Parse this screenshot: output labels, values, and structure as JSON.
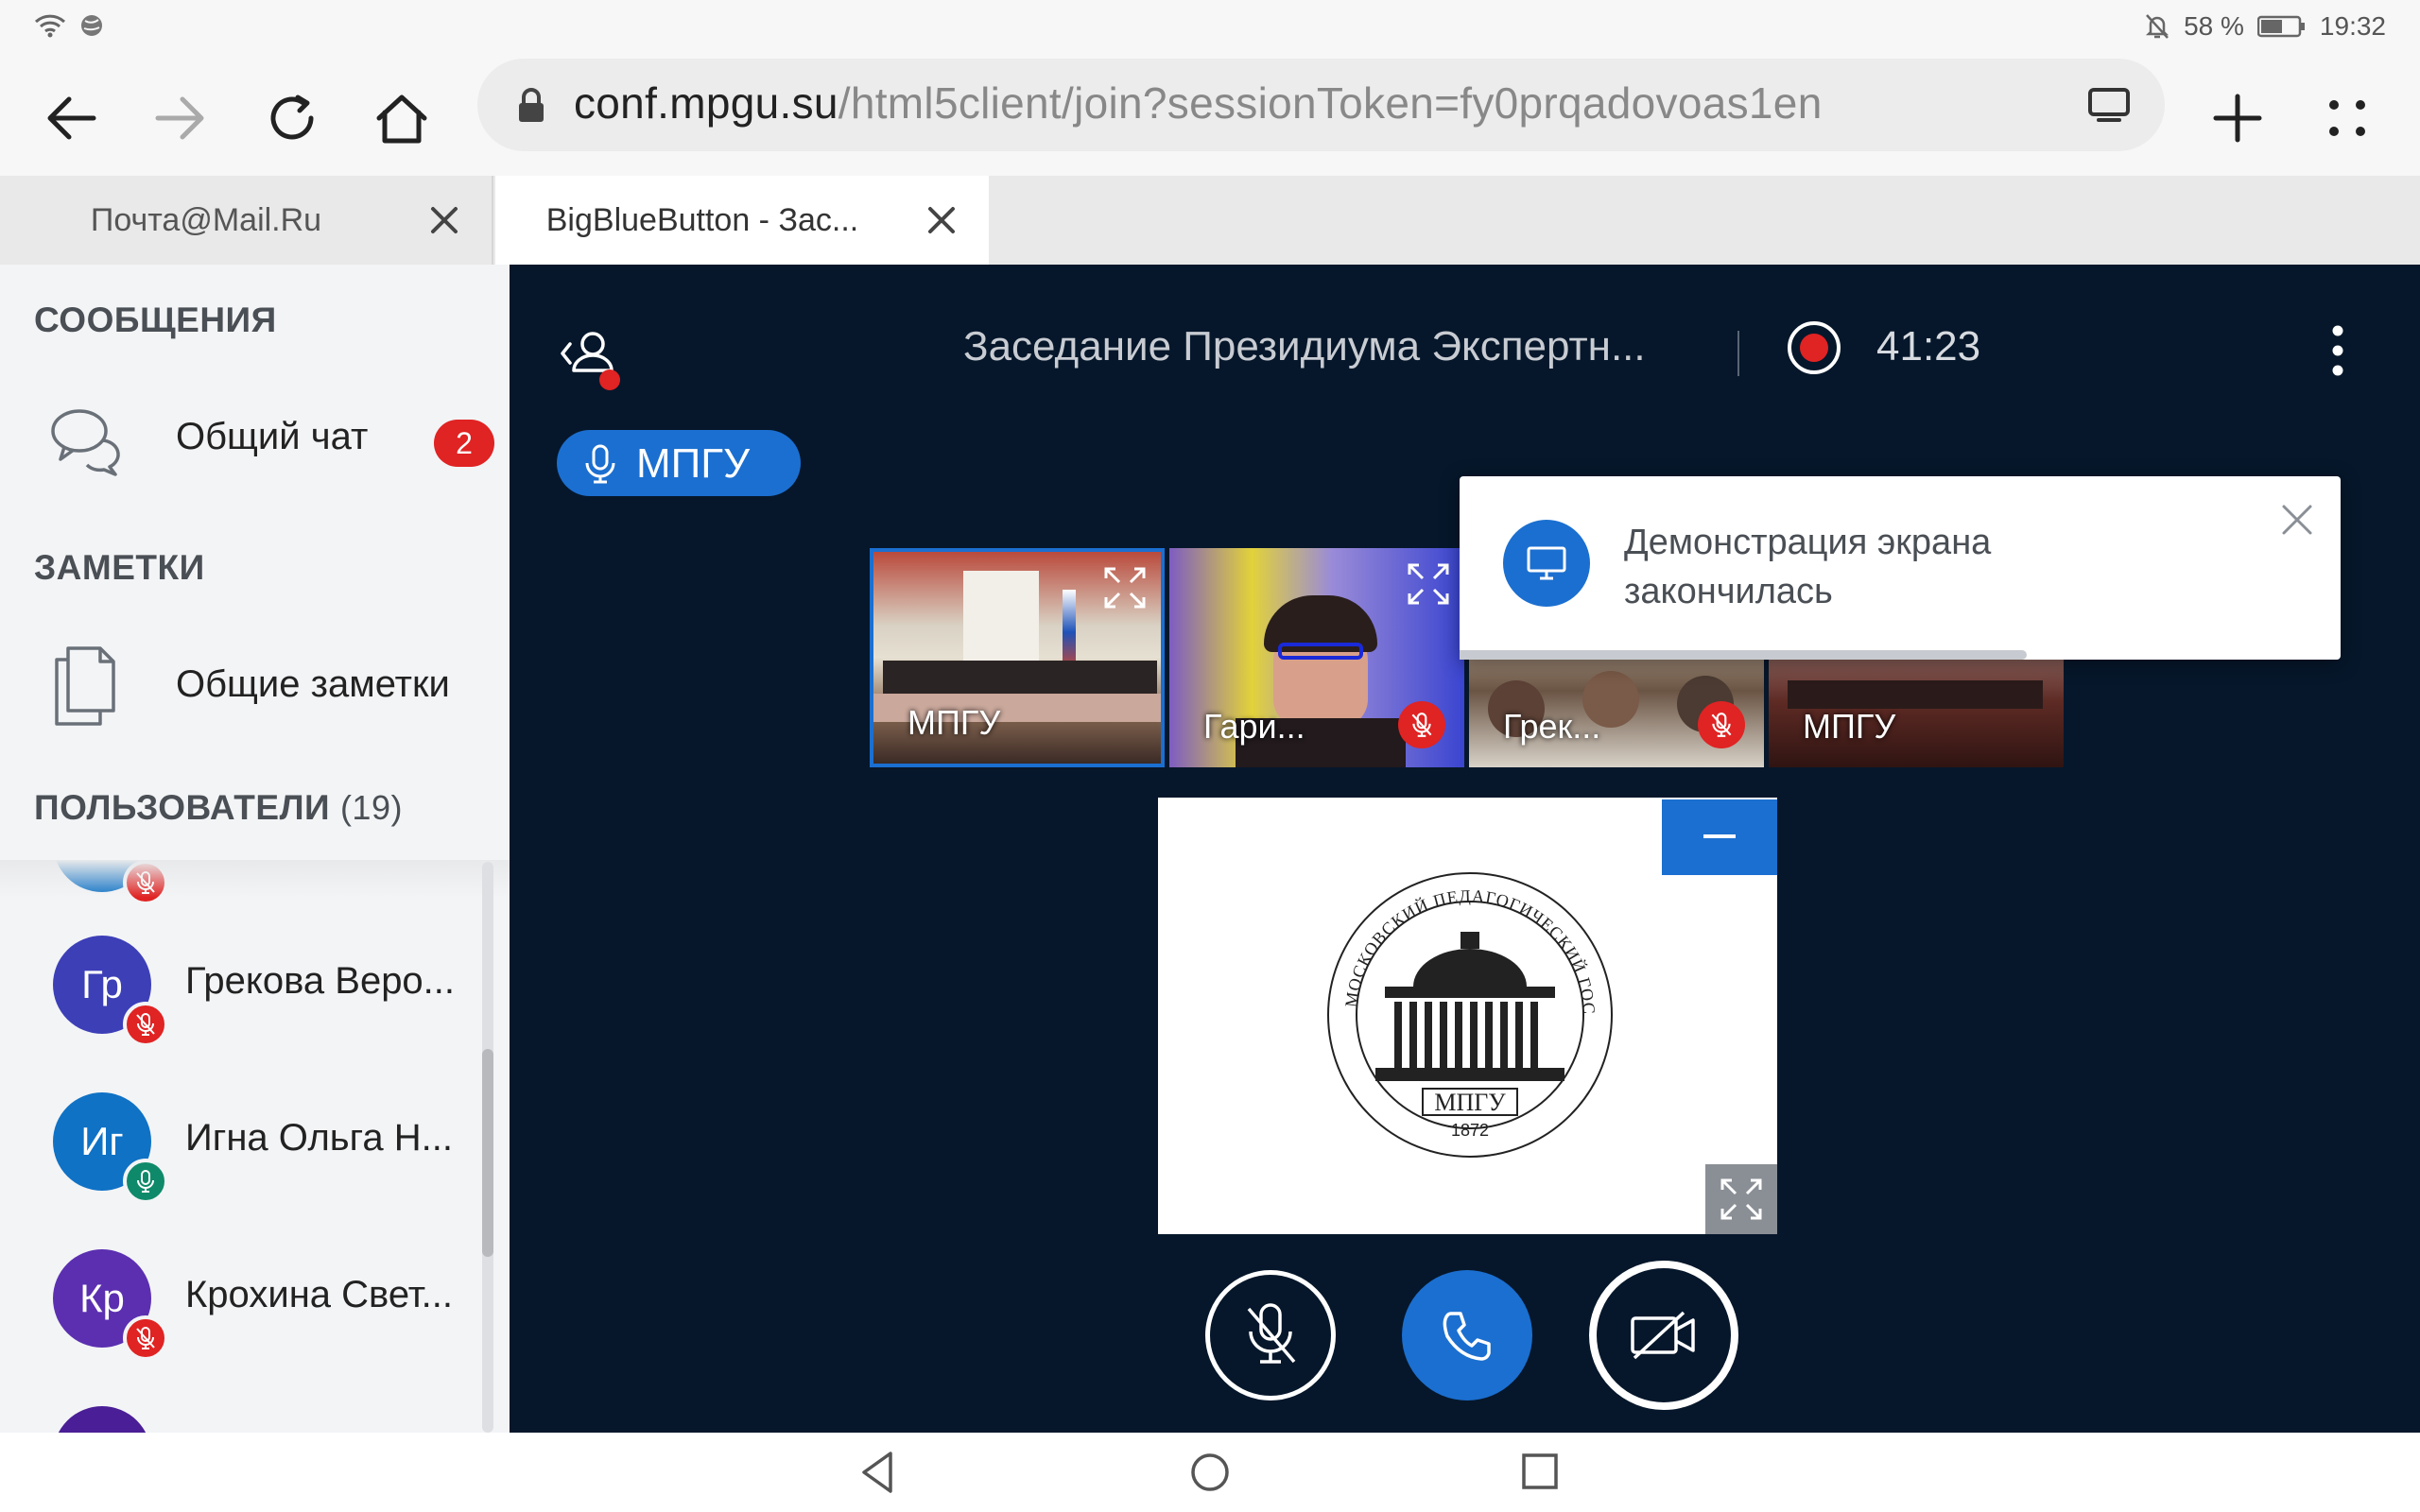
{
  "status_bar": {
    "battery": "58 %",
    "time": "19:32"
  },
  "browser": {
    "url_host": "conf.mpgu.su",
    "url_path": "/html5client/join?sessionToken=fy0prqadovoas1en",
    "tabs": [
      {
        "label": "Почта@Mail.Ru",
        "active": false
      },
      {
        "label": "BigBlueButton - Зас...",
        "active": true
      }
    ]
  },
  "sidebar": {
    "messages_title": "СООБЩЕНИЯ",
    "public_chat": "Общий чат",
    "public_chat_unread": "2",
    "notes_title": "ЗАМЕТКИ",
    "shared_notes": "Общие заметки",
    "users_title": "ПОЛЬЗОВАТЕЛИ",
    "users_count": "(19)",
    "users": [
      {
        "initials": "Гр",
        "name": "Грекова Веро...",
        "color": "#3d3fb7",
        "mic": "muted"
      },
      {
        "initials": "Иг",
        "name": "Игна Ольга Н...",
        "color": "#0f72c5",
        "mic": "on"
      },
      {
        "initials": "Кр",
        "name": "Крохина Свет...",
        "color": "#5b2fb0",
        "mic": "muted"
      }
    ]
  },
  "meeting": {
    "title": "Заседание Президиума Экспертн...",
    "timer": "41:23",
    "talking": "МПГУ",
    "videos": [
      {
        "name": "МПГУ",
        "muted": false
      },
      {
        "name": "Гари...",
        "muted": true
      },
      {
        "name": "Грек...",
        "muted": true
      },
      {
        "name": "МПГУ",
        "muted": false
      }
    ],
    "notification": "Демонстрация экрана закончилась",
    "logo_text": "МОСКОВСКИЙ ПЕДАГОГИЧЕСКИЙ ГОСУДАРСТВЕННЫЙ УНИВЕРСИТЕТ",
    "logo_abbr": "МПГУ",
    "logo_year": "1872"
  },
  "colors": {
    "accent": "#1b6fd0",
    "main_bg": "#06172b",
    "danger": "#e02323",
    "mic_on": "#0e8a6a"
  }
}
